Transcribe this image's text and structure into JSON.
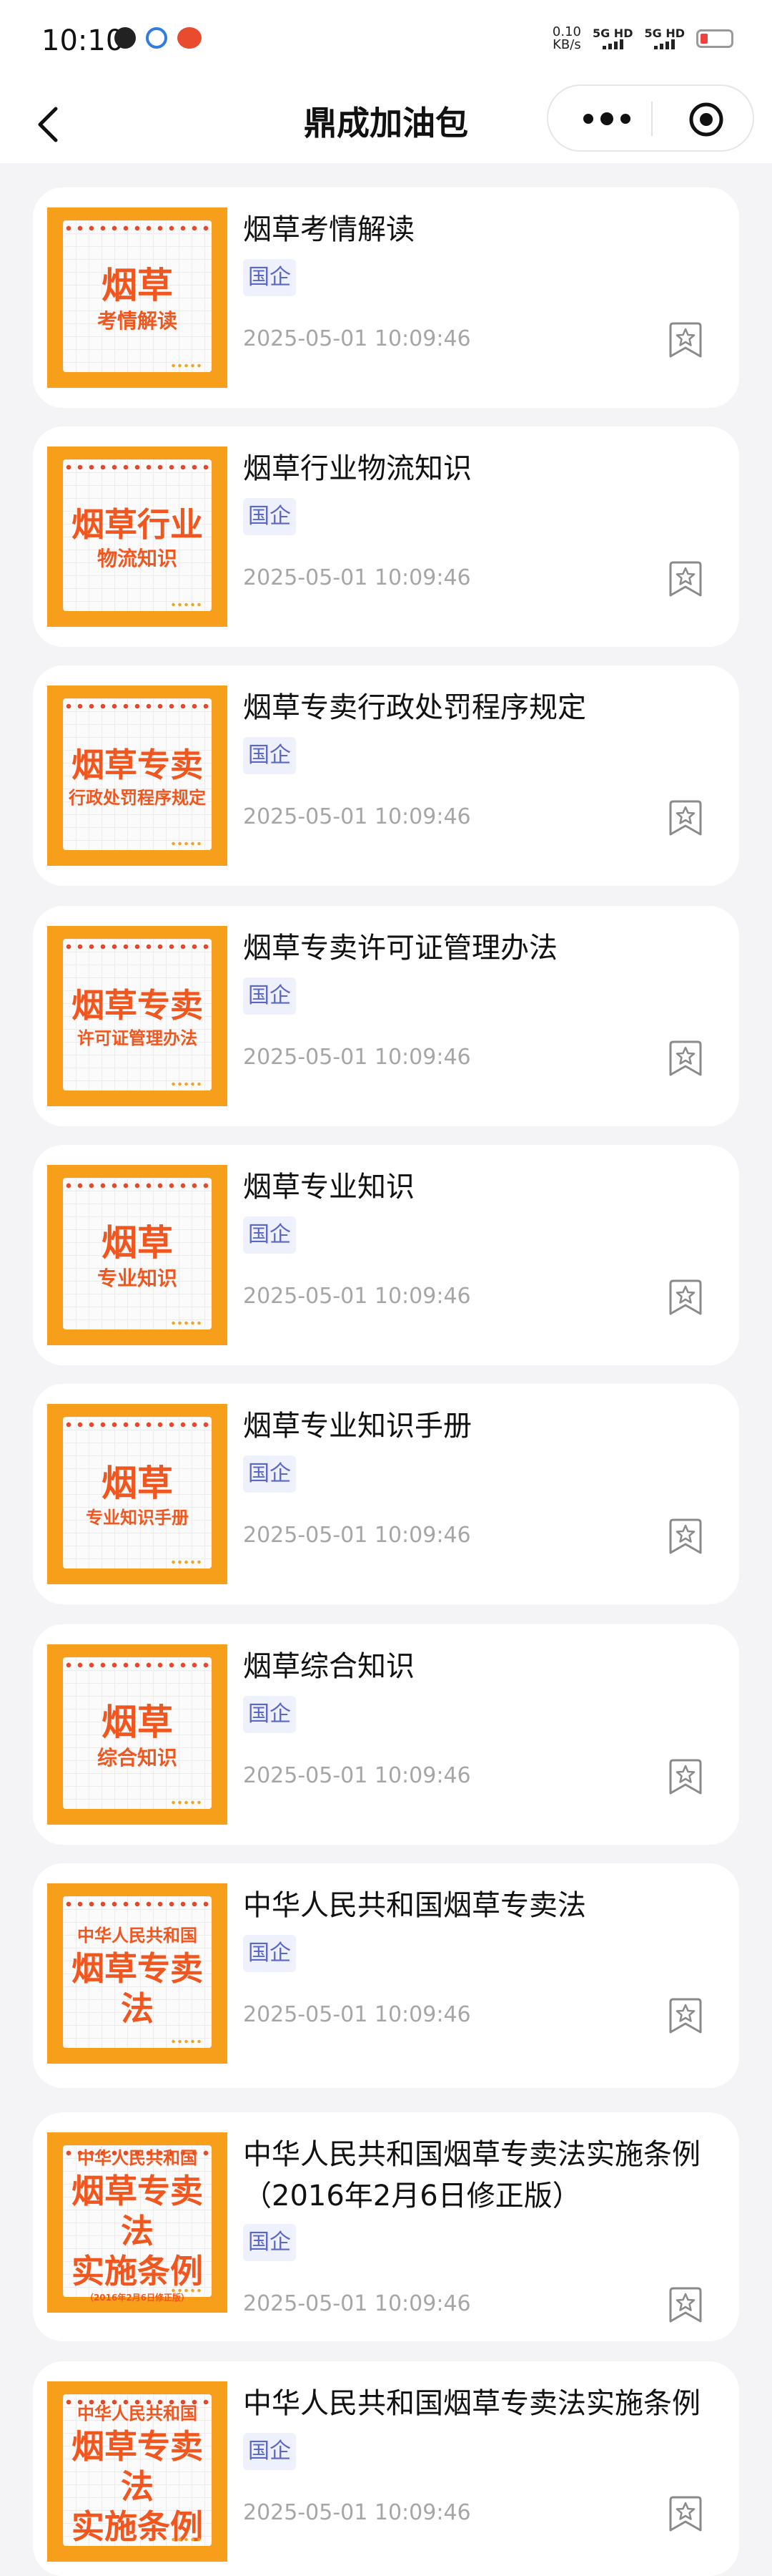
{
  "status_bar": {
    "time": "10:10",
    "speed_value": "0.10",
    "speed_unit": "KB/s",
    "signal1": "5G HD",
    "signal2": "5G HD"
  },
  "nav": {
    "title": "鼎成加油包",
    "back_icon": "chevron-left-icon",
    "more_icon": "more-dots-icon",
    "target_icon": "target-icon"
  },
  "colors": {
    "accent_orange": "#f0561e",
    "thumb_orange": "#f79e1b",
    "tag_bg": "#eef1fc",
    "tag_text": "#5a67c8"
  },
  "items": [
    {
      "title": "烟草考情解读",
      "tag": "国企",
      "date": "2025-05-01 10:09:46",
      "thumb_lines": [
        "烟草",
        "考情解读"
      ]
    },
    {
      "title": "烟草行业物流知识",
      "tag": "国企",
      "date": "2025-05-01 10:09:46",
      "thumb_lines": [
        "烟草行业",
        "物流知识"
      ]
    },
    {
      "title": "烟草专卖行政处罚程序规定",
      "tag": "国企",
      "date": "2025-05-01 10:09:46",
      "thumb_lines": [
        "烟草专卖",
        "行政处罚程序规定"
      ]
    },
    {
      "title": "烟草专卖许可证管理办法",
      "tag": "国企",
      "date": "2025-05-01 10:09:46",
      "thumb_lines": [
        "烟草专卖",
        "许可证管理办法"
      ]
    },
    {
      "title": "烟草专业知识",
      "tag": "国企",
      "date": "2025-05-01 10:09:46",
      "thumb_lines": [
        "烟草",
        "专业知识"
      ]
    },
    {
      "title": "烟草专业知识手册",
      "tag": "国企",
      "date": "2025-05-01 10:09:46",
      "thumb_lines": [
        "烟草",
        "专业知识手册"
      ]
    },
    {
      "title": "烟草综合知识",
      "tag": "国企",
      "date": "2025-05-01 10:09:46",
      "thumb_lines": [
        "烟草",
        "综合知识"
      ]
    },
    {
      "title": "中华人民共和国烟草专卖法",
      "tag": "国企",
      "date": "2025-05-01 10:09:46",
      "thumb_lines": [
        "中华人民共和国",
        "烟草专卖法"
      ]
    },
    {
      "title": "中华人民共和国烟草专卖法实施条例（2016年2月6日修正版）",
      "tag": "国企",
      "date": "2025-05-01 10:09:46",
      "thumb_lines": [
        "中华人民共和国",
        "烟草专卖法",
        "实施条例",
        "（2016年2月6日修正版）"
      ]
    },
    {
      "title": "中华人民共和国烟草专卖法实施条例",
      "tag": "国企",
      "date": "2025-05-01 10:09:46",
      "thumb_lines": [
        "中华人民共和国",
        "烟草专卖法",
        "实施条例"
      ]
    }
  ]
}
